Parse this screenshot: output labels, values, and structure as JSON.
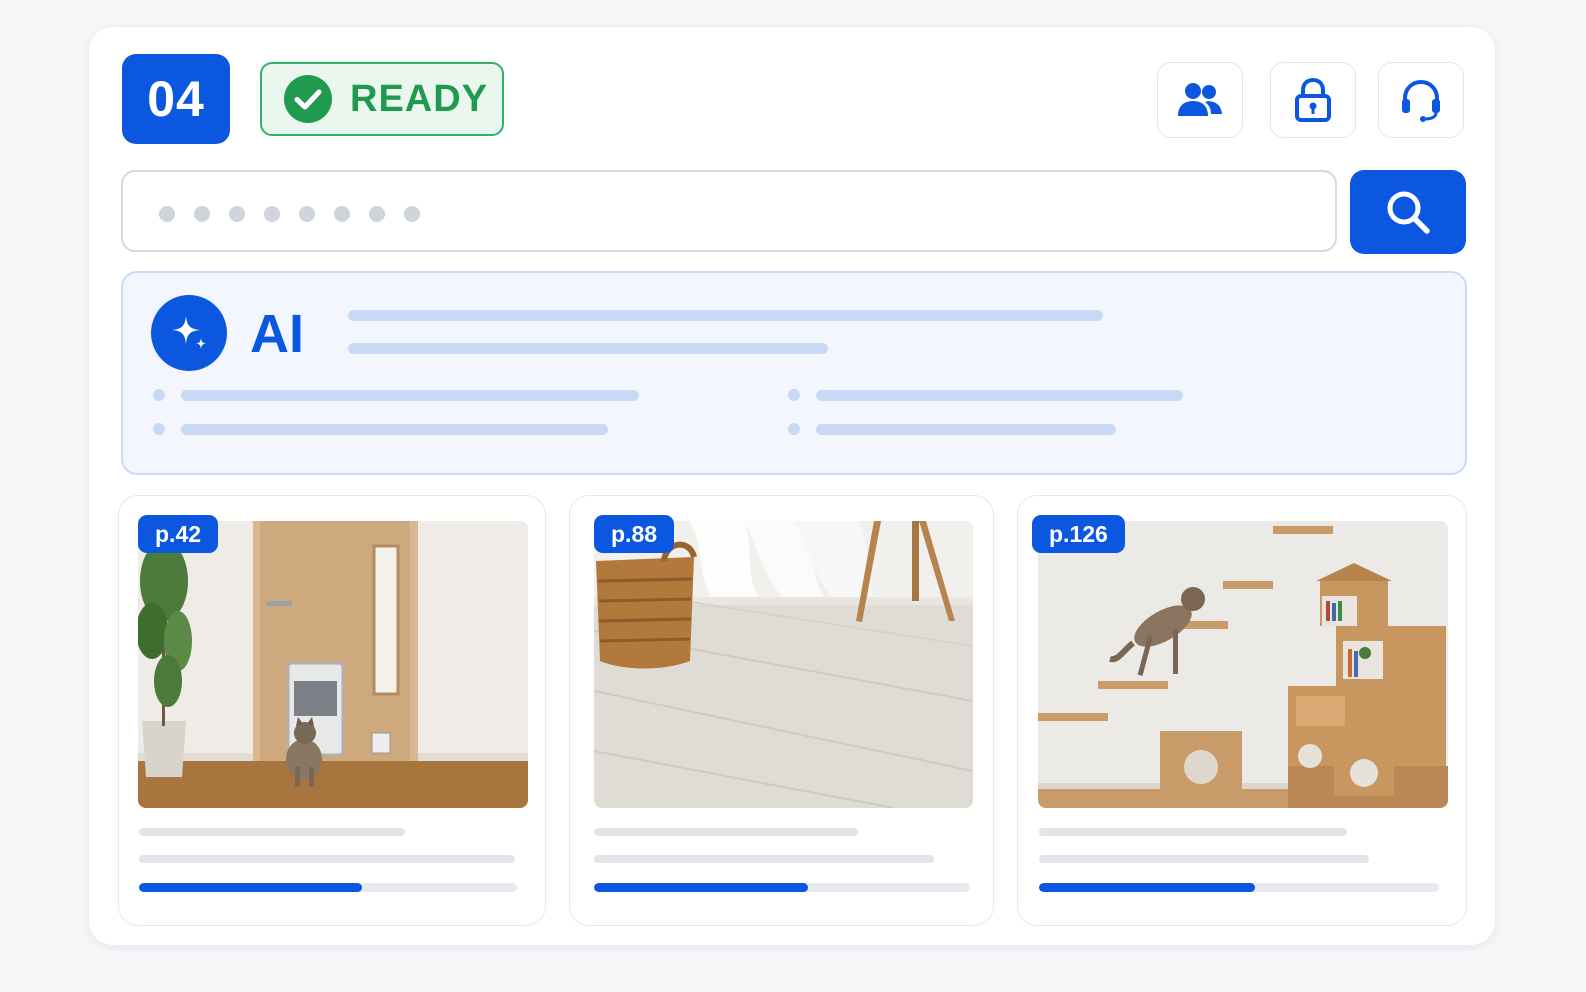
{
  "header": {
    "step_number": "04",
    "status_label": "READY",
    "status_color": "#1f9a4e",
    "accent_color": "#0b57e0",
    "icons": [
      "users-icon",
      "lock-icon",
      "headset-icon"
    ]
  },
  "search": {
    "placeholder_mask": "••••••••",
    "button_icon": "search-icon"
  },
  "ai_summary": {
    "title": "AI",
    "icon": "sparkle-icon"
  },
  "results": [
    {
      "page": "p.42",
      "image": "room with cat flap in a wooden door",
      "progress": 0.59
    },
    {
      "page": "p.88",
      "image": "light wooden floor with wicker basket",
      "progress": 0.57
    },
    {
      "page": "p.126",
      "image": "cat climbing wall shelves next to cat tower",
      "progress": 0.54
    }
  ]
}
